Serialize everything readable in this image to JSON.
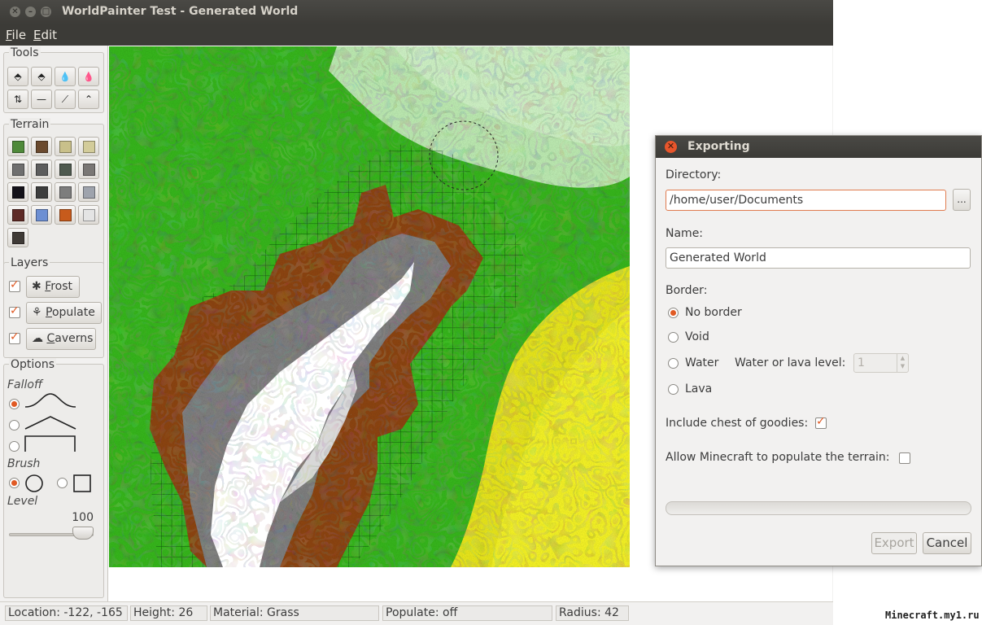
{
  "window": {
    "title": "WorldPainter Test - Generated World",
    "controls": [
      "close",
      "minimize",
      "maximize"
    ]
  },
  "menu": {
    "items": [
      {
        "label": "File",
        "mnemonic": "F",
        "rest": "ile"
      },
      {
        "label": "Edit",
        "mnemonic": "E",
        "rest": "dit"
      }
    ]
  },
  "tools": {
    "title": "Tools",
    "buttons": [
      {
        "icon": "raise-terrain-icon",
        "glyph": "⬘"
      },
      {
        "icon": "lower-terrain-icon",
        "glyph": "⬘"
      },
      {
        "icon": "flood-water-icon",
        "glyph": "💧"
      },
      {
        "icon": "flood-lava-icon",
        "glyph": "💧"
      },
      {
        "icon": "smooth-icon",
        "glyph": "⇅"
      },
      {
        "icon": "flatten-icon",
        "glyph": "—"
      },
      {
        "icon": "slope-icon",
        "glyph": "⟋"
      },
      {
        "icon": "mountain-icon",
        "glyph": "⌃"
      }
    ]
  },
  "terrain": {
    "title": "Terrain",
    "tiles": [
      {
        "name": "grass",
        "color": "#4f8a3a"
      },
      {
        "name": "dirt",
        "color": "#6b4a2e"
      },
      {
        "name": "sand",
        "color": "#c9c08a"
      },
      {
        "name": "sandstone",
        "color": "#d3cc9a"
      },
      {
        "name": "stone",
        "color": "#6f6f6f"
      },
      {
        "name": "cobblestone",
        "color": "#5d5d5d"
      },
      {
        "name": "mossy-cobblestone",
        "color": "#4f5a4f"
      },
      {
        "name": "gravel",
        "color": "#7a7775"
      },
      {
        "name": "obsidian",
        "color": "#14121a"
      },
      {
        "name": "bedrock",
        "color": "#3d3d3d"
      },
      {
        "name": "stone-bricks",
        "color": "#7d7d7d"
      },
      {
        "name": "clay",
        "color": "#9ea3ad"
      },
      {
        "name": "netherrack",
        "color": "#5e2a26"
      },
      {
        "name": "water",
        "color": "#6d8fd3"
      },
      {
        "name": "lava",
        "color": "#c75b1c"
      },
      {
        "name": "snow",
        "color": "#e4e4e4"
      },
      {
        "name": "deep-snow",
        "color": "#3f3a36"
      }
    ]
  },
  "layers": {
    "title": "Layers",
    "items": [
      {
        "label": "Frost",
        "mnemonic": "F",
        "rest": "rost",
        "checked": true,
        "icon": "snowflake-icon",
        "glyph": "✱"
      },
      {
        "label": "Populate",
        "mnemonic": "P",
        "rest": "opulate",
        "checked": true,
        "icon": "tree-icon",
        "glyph": "⚘"
      },
      {
        "label": "Caverns",
        "mnemonic": "C",
        "rest": "averns",
        "checked": true,
        "icon": "cave-icon",
        "glyph": "☁"
      }
    ]
  },
  "options": {
    "title": "Options",
    "falloff_label": "Falloff",
    "falloff_selected": 0,
    "brush_label": "Brush",
    "brush_selected": "circle",
    "level_label": "Level",
    "level_value": "100",
    "level_fraction": 1.0
  },
  "status": {
    "location": "Location: -122, -165",
    "height": "Height: 26",
    "material": "Material: Grass",
    "populate": "Populate: off",
    "radius": "Radius: 42"
  },
  "dialog": {
    "title": "Exporting",
    "directory_label": "Directory:",
    "directory_value": "/home/user/Documents",
    "browse_label": "...",
    "name_label": "Name:",
    "name_value": "Generated World",
    "border_label": "Border:",
    "border_options": [
      {
        "label": "No border",
        "selected": true
      },
      {
        "label": "Void",
        "selected": false
      },
      {
        "label": "Water",
        "selected": false
      },
      {
        "label": "Lava",
        "selected": false
      }
    ],
    "water_level_label": "Water or lava level:",
    "water_level_value": "1",
    "chest_label": "Include chest of goodies:",
    "chest_checked": true,
    "populate_label": "Allow Minecraft to populate the terrain:",
    "populate_checked": false,
    "progress": 0,
    "export_label": "Export",
    "cancel_label": "Cancel"
  },
  "watermark": "Minecraft.my1.ru"
}
